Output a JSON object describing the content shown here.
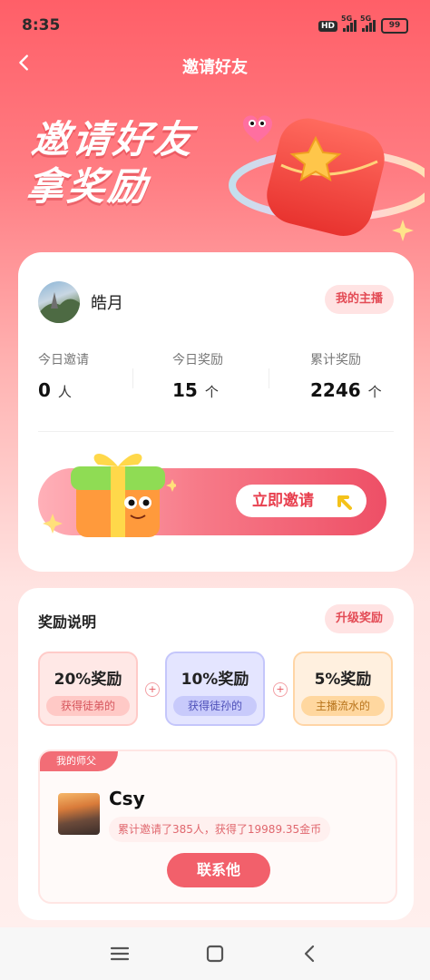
{
  "status": {
    "time": "8:35",
    "hd_label": "HD",
    "signal1_label": "5G",
    "signal2_label": "5G",
    "battery": "99"
  },
  "nav": {
    "title": "邀请好友"
  },
  "hero": {
    "line1": "邀请好友",
    "line2": "拿奖励"
  },
  "user": {
    "name": "皓月",
    "my_anchor_label": "我的主播"
  },
  "stats": [
    {
      "label": "今日邀请",
      "value": "0",
      "unit": "人"
    },
    {
      "label": "今日奖励",
      "value": "15",
      "unit": "个"
    },
    {
      "label": "累计奖励",
      "value": "2246",
      "unit": "个"
    }
  ],
  "invite": {
    "button_label": "立即邀请"
  },
  "rewards": {
    "title": "奖励说明",
    "upgrade_label": "升级奖励",
    "tiers": [
      {
        "percent": "20%奖励",
        "desc": "获得徒弟的"
      },
      {
        "percent": "10%奖励",
        "desc": "获得徒孙的"
      },
      {
        "percent": "5%奖励",
        "desc": "主播流水的"
      }
    ]
  },
  "master": {
    "tag": "我的师父",
    "name": "Csy",
    "desc": "累计邀请了385人，获得了19989.35金币",
    "contact_label": "联系他"
  },
  "colors": {
    "primary": "#f2606b",
    "accent_text": "#e34b55",
    "header_top": "#ff5f68"
  }
}
